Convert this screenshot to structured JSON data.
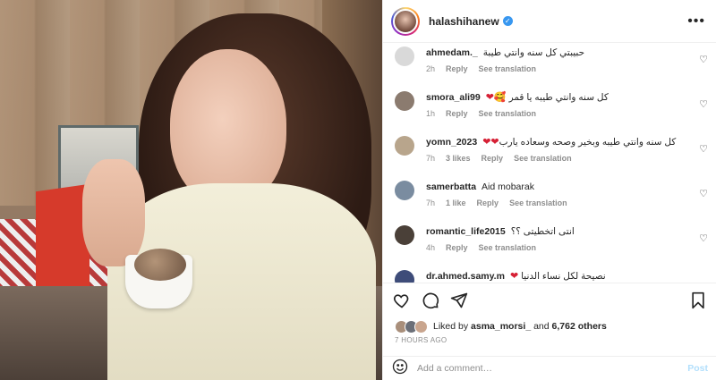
{
  "post": {
    "username": "halashihanew",
    "liked_by_prefix": "Liked by",
    "liked_by_user": "asma_morsi_",
    "liked_by_and": "and",
    "liked_by_others": "6,762 others",
    "time": "7 HOURS AGO",
    "add_comment_placeholder": "Add a comment…",
    "post_label": "Post"
  },
  "icons": {
    "more": "more-icon",
    "verified": "verified-badge-icon",
    "heart": "heart-icon",
    "comment": "comment-icon",
    "share": "share-icon",
    "bookmark": "bookmark-icon",
    "emoji": "emoji-icon"
  },
  "colors": {
    "verified_blue": "#3897f0",
    "heart_red": "#d62035",
    "muted_text": "#8e8e8e",
    "post_disabled": "#b2dffc"
  },
  "comments": [
    {
      "user": "ahmedam._",
      "text": "حبيبتي كل سنه وانتي طيبة",
      "emoji": "",
      "time": "2h",
      "likes": "",
      "reply": "Reply",
      "translate": "See translation",
      "avatar_color": "#cfcfcf"
    },
    {
      "user": "smora_ali99",
      "text": "كل سنه وانتي طيبه يا قمر",
      "emoji": "🥰❤",
      "time": "1h",
      "likes": "",
      "reply": "Reply",
      "translate": "See translation",
      "avatar_color": "#8b7b6f"
    },
    {
      "user": "yomn_2023",
      "text": "كل سنه وانتي طيبه وبخير وصحه وسعاده يارب",
      "emoji": "❤❤",
      "time": "7h",
      "likes": "3 likes",
      "reply": "Reply",
      "translate": "See translation",
      "avatar_color": "#b8a58c"
    },
    {
      "user": "samerbatta",
      "text": "Aid mobarak",
      "emoji": "",
      "time": "7h",
      "likes": "1 like",
      "reply": "Reply",
      "translate": "See translation",
      "avatar_color": "#7a8ca0"
    },
    {
      "user": "romantic_life2015",
      "text": "انتى اتخطيتى ؟؟",
      "emoji": "",
      "time": "4h",
      "likes": "",
      "reply": "Reply",
      "translate": "See translation",
      "avatar_color": "#4a4038"
    },
    {
      "user": "dr.ahmed.samy.m",
      "text": "نصيحة لكل نساء الدنيا",
      "emoji": "❤",
      "time": "",
      "likes": "",
      "reply": "",
      "translate": "",
      "avatar_color": "#3e4c79"
    }
  ]
}
